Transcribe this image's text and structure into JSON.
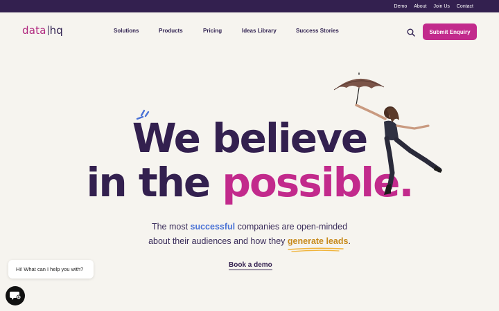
{
  "topbar": {
    "links": [
      "Demo",
      "About",
      "Join Us",
      "Contact"
    ]
  },
  "header": {
    "logo_left": "data",
    "logo_right": "hq",
    "menu": [
      "Solutions",
      "Products",
      "Pricing",
      "Ideas Library",
      "Success Stories"
    ],
    "search_icon": "search-icon",
    "cta_label": "Submit Enquiry"
  },
  "hero": {
    "line1": "We believe",
    "line2_plain": "in the ",
    "line2_accent": "possible.",
    "sub_part1": "The most ",
    "sub_blue": "successful",
    "sub_part2": " companies are open-minded",
    "sub_part3": "about their audiences and how they ",
    "sub_under": "generate leads",
    "sub_end": ".",
    "demo_link": "Book a demo"
  },
  "chat": {
    "bubble_text": "Hi! What can I help you with?",
    "icon": "chat-icon"
  },
  "colors": {
    "topbar": "#33204f",
    "accent": "#c22a8c",
    "blue": "#4a72d6",
    "gold": "#c78a1c",
    "background": "#f6f4ef"
  }
}
